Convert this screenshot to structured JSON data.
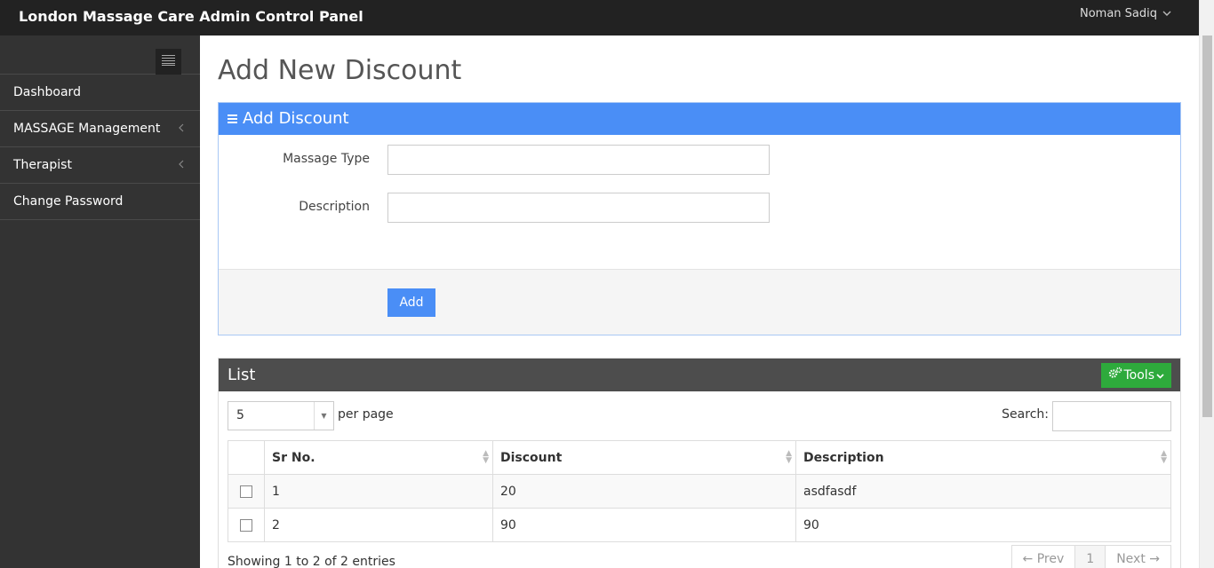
{
  "header": {
    "title": "London Massage Care Admin Control Panel",
    "user_name": "Noman Sadiq"
  },
  "sidebar": {
    "items": [
      {
        "label": "Dashboard",
        "has_submenu": false
      },
      {
        "label": "MASSAGE Management",
        "has_submenu": true
      },
      {
        "label": "Therapist",
        "has_submenu": true
      },
      {
        "label": "Change Password",
        "has_submenu": false
      }
    ]
  },
  "page": {
    "title": "Add New Discount"
  },
  "form": {
    "heading": "Add Discount",
    "fields": [
      {
        "label": "Massage Type",
        "value": "",
        "placeholder": ""
      },
      {
        "label": "Description",
        "value": "",
        "placeholder": ""
      }
    ],
    "submit_label": "Add"
  },
  "list": {
    "heading": "List",
    "tools_label": "Tools",
    "per_page_value": "5",
    "per_page_label": "per page",
    "search_label": "Search:",
    "search_value": "",
    "columns": [
      "Sr No.",
      "Discount",
      "Description"
    ],
    "rows": [
      {
        "sr": "1",
        "discount": "20",
        "description": "asdfasdf"
      },
      {
        "sr": "2",
        "discount": "90",
        "description": "90"
      }
    ],
    "info": "Showing 1 to 2 of 2 entries",
    "pagination": {
      "prev": "← Prev",
      "current": "1",
      "next": "Next →"
    }
  },
  "colors": {
    "topbar": "#222222",
    "sidebar": "#333333",
    "primary": "#4a8ef6",
    "list_header": "#4d4d4d",
    "tools": "#2eaa3c"
  }
}
